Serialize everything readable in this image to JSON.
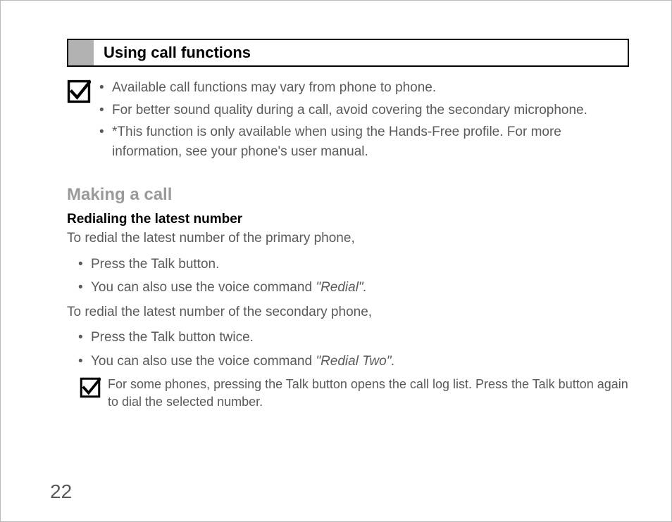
{
  "section_title": "Using call functions",
  "top_notes": [
    "Available call functions may vary from phone to phone.",
    "For better sound quality during a call, avoid covering the secondary microphone.",
    "*This function is only available when using the Hands-Free profile. For more information, see your phone's user manual."
  ],
  "h2": "Making a call",
  "h3": "Redialing the latest number",
  "p1": "To redial the latest number of the primary phone,",
  "steps1": {
    "a": "Press the Talk button.",
    "b_pre": "You can also use the voice command ",
    "b_it": "\"Redial\"."
  },
  "p2": "To redial the latest number of the secondary phone,",
  "steps2": {
    "a": "Press the Talk button twice.",
    "b_pre": "You can also use the voice command ",
    "b_it": "\"Redial Two\"."
  },
  "bottom_note": "For some phones, pressing the Talk button opens the call log list. Press the Talk button again to dial the selected number.",
  "page_number": "22"
}
